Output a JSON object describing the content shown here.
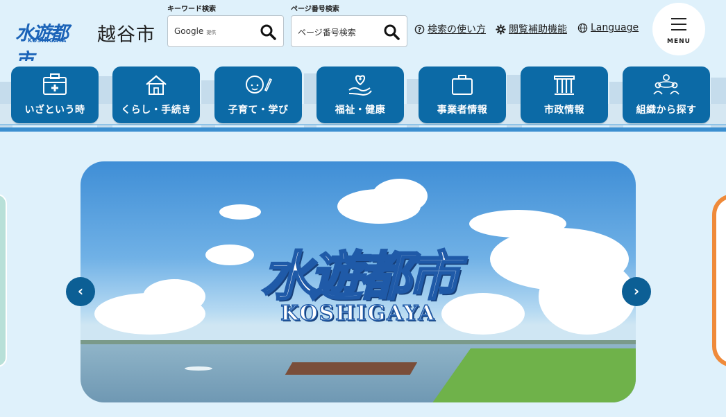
{
  "header": {
    "logo_mark": "水遊都市",
    "logo_sub": "KOSHIGAYA",
    "city_name": "越谷市",
    "keyword_search": {
      "label": "キーワード検索",
      "engine": "Google",
      "engine_note": "提供"
    },
    "page_search": {
      "label": "ページ番号検索",
      "placeholder": "ページ番号検索"
    },
    "links": {
      "search_help": "検索の使い方",
      "accessibility": "閲覧補助機能",
      "language": "Language"
    },
    "menu_label": "MENU"
  },
  "nav": {
    "items": [
      {
        "label": "いざという時",
        "icon": "first-aid-icon"
      },
      {
        "label": "くらし・手続き",
        "icon": "house-icon"
      },
      {
        "label": "子育て・学び",
        "icon": "child-pencil-icon"
      },
      {
        "label": "福祉・健康",
        "icon": "heart-hand-icon"
      },
      {
        "label": "事業者情報",
        "icon": "briefcase-icon"
      },
      {
        "label": "市政情報",
        "icon": "building-icon"
      },
      {
        "label": "組織から探す",
        "icon": "people-group-icon"
      }
    ]
  },
  "carousel": {
    "slide_title": "水遊都市",
    "slide_subtitle": "KOSHIGAYA",
    "prev_label": "‹",
    "next_label": "›"
  },
  "colors": {
    "accent": "#0c6aa6",
    "background": "#dff1fb",
    "arrow": "#0c5f95",
    "peek_right": "#ef8a3a"
  }
}
